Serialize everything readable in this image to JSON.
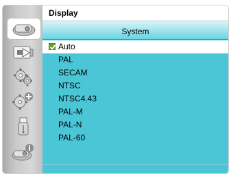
{
  "header": {
    "title": "Display"
  },
  "submenu": {
    "title": "System"
  },
  "options": [
    {
      "label": "Auto",
      "checked": true
    },
    {
      "label": "PAL"
    },
    {
      "label": "SECAM"
    },
    {
      "label": "NTSC"
    },
    {
      "label": "NTSC4.43"
    },
    {
      "label": "PAL-M"
    },
    {
      "label": "PAL-N"
    },
    {
      "label": "PAL-60"
    }
  ],
  "sidebar": {
    "items": [
      {
        "icon": "display-icon",
        "active": true
      },
      {
        "icon": "input-icon"
      },
      {
        "icon": "gear-icon"
      },
      {
        "icon": "gear-plus-icon"
      },
      {
        "icon": "usb-icon"
      },
      {
        "icon": "info-icon"
      }
    ]
  },
  "colors": {
    "panel": "#4ac6d6",
    "selected_row": "#ffffff",
    "checkbox": "#6f9d2a"
  }
}
